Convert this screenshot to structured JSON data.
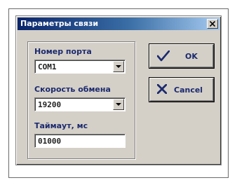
{
  "dialog": {
    "title": "Параметры связи",
    "close_glyph": "×"
  },
  "port": {
    "label": "Номер порта",
    "value": "COM1"
  },
  "speed": {
    "label": "Скорость обмена",
    "value": "19200"
  },
  "timeout": {
    "label": "Таймаут, мс",
    "value": "01000"
  },
  "buttons": {
    "ok_label": "OK",
    "cancel_label": "Cancel"
  },
  "icons": {
    "ok": "checkmark-icon",
    "cancel": "x-mark-icon",
    "dropdown": "dropdown-arrow-icon",
    "close": "close-icon"
  },
  "colors": {
    "title_start": "#0a246a",
    "title_end": "#a6caf0",
    "dialog_bg": "#d4d0c8",
    "label_text": "#1c2a6e"
  }
}
